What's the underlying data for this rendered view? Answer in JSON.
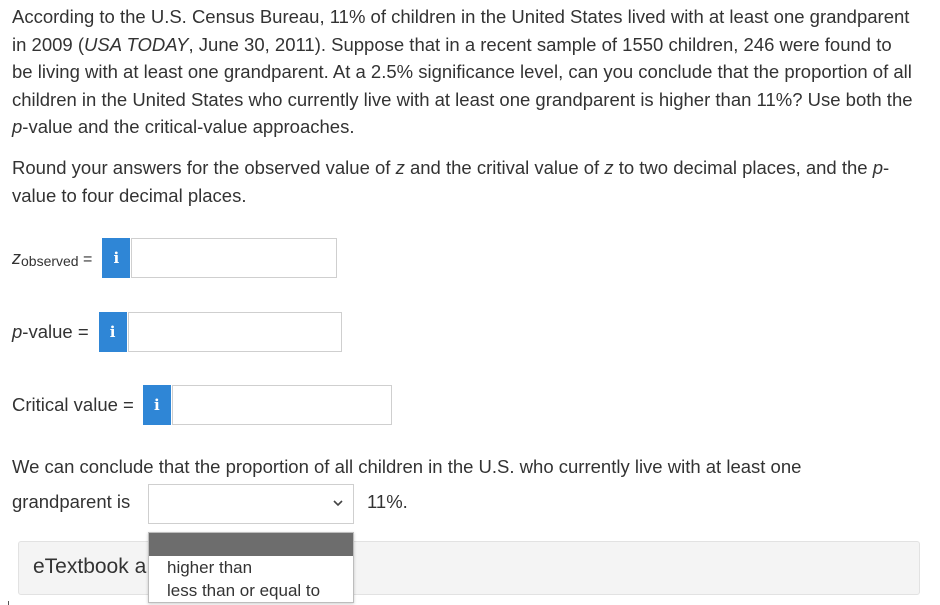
{
  "question": {
    "parts": [
      {
        "text": "According to the U.S. Census Bureau, 11% of children in the United States lived with at least one grandparent in 2009 (",
        "italic": false
      },
      {
        "text": "USA TODAY",
        "italic": true
      },
      {
        "text": ", June 30, 2011). Suppose that in a recent sample of 1550 children, 246 were found to be living with at least one grandparent. At a 2.5% significance level, can you conclude that the proportion of all children in the United States who currently live with at least one grandparent is higher than 11%? Use both the ",
        "italic": false
      },
      {
        "text": "p",
        "italic": true
      },
      {
        "text": "-value and the critical-value approaches.",
        "italic": false
      }
    ]
  },
  "instructions": {
    "parts": [
      {
        "text": "Round your answers for the observed value of ",
        "italic": false
      },
      {
        "text": "z",
        "italic": true
      },
      {
        "text": " and the critival value of ",
        "italic": false
      },
      {
        "text": "z",
        "italic": true
      },
      {
        "text": " to two decimal places, and the ",
        "italic": false
      },
      {
        "text": "p",
        "italic": true
      },
      {
        "text": "-value to four decimal places.",
        "italic": false
      }
    ]
  },
  "fields": {
    "z_observed": {
      "label_main": "z",
      "label_sub": "observed",
      "label_eq": " =",
      "info_icon": "i",
      "value": ""
    },
    "p_value": {
      "label_italic": "p",
      "label_rest": "-value =",
      "info_icon": "i",
      "value": ""
    },
    "critical_value": {
      "label": "Critical value =",
      "info_icon": "i",
      "value": ""
    }
  },
  "conclusion": {
    "line1": "We can conclude that the proportion of all children in the U.S. who currently live with at least one",
    "line2_prefix": "grandparent is",
    "selected": "",
    "suffix": "11%.",
    "options": [
      "higher than",
      "less than or equal to"
    ]
  },
  "etextbook": {
    "label": "eTextbook a"
  },
  "colors": {
    "info_button": "#2f86d6",
    "dropdown_header": "#6d6d6d"
  }
}
